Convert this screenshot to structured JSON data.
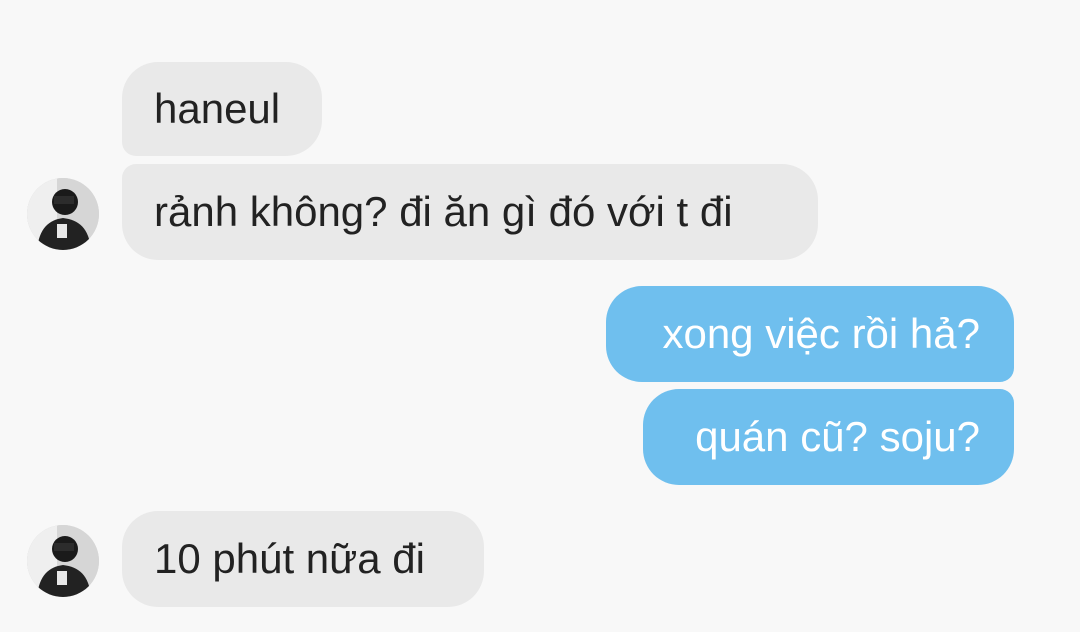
{
  "messages": [
    {
      "sender": "contact",
      "text": "haneul"
    },
    {
      "sender": "contact",
      "text": "rảnh không? đi ăn gì đó với t đi"
    },
    {
      "sender": "me",
      "text": "xong việc rồi hả?"
    },
    {
      "sender": "me",
      "text": "quán cũ? soju?"
    },
    {
      "sender": "contact",
      "text": "10 phút nữa đi"
    }
  ],
  "colors": {
    "background": "#f8f8f8",
    "incoming_bubble": "#e9e9e9",
    "outgoing_bubble": "#6fbfee",
    "incoming_text": "#222222",
    "outgoing_text": "#ffffff"
  },
  "avatar": {
    "icon": "contact-avatar-photo"
  }
}
